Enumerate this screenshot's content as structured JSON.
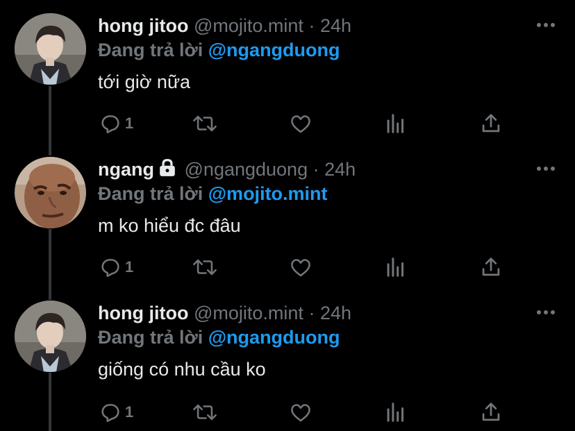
{
  "colors": {
    "background": "#000000",
    "text_primary": "#e7e9ea",
    "text_secondary": "#71767b",
    "mention": "#1d9bf0",
    "thread_line": "#333639"
  },
  "tweets": [
    {
      "display_name": "hong jitoo",
      "handle": "@mojito.mint",
      "separator": "·",
      "time": "24h",
      "locked": false,
      "replying_label": "Đang trả lời",
      "replying_to": "@ngangduong",
      "text": "tới giờ nữa",
      "reply_count": "1",
      "avatar_icon": "profile-photo"
    },
    {
      "display_name": "ngang",
      "handle": "@ngangduong",
      "separator": "·",
      "time": "24h",
      "locked": true,
      "replying_label": "Đang trả lời",
      "replying_to": "@mojito.mint",
      "text": "m ko hiểu đc đâu",
      "reply_count": "1",
      "avatar_icon": "profile-photo"
    },
    {
      "display_name": "hong jitoo",
      "handle": "@mojito.mint",
      "separator": "·",
      "time": "24h",
      "locked": false,
      "replying_label": "Đang trả lời",
      "replying_to": "@ngangduong",
      "text": "giống có nhu cầu ko",
      "reply_count": "1",
      "avatar_icon": "profile-photo"
    }
  ],
  "action_icons": [
    "reply-icon",
    "retweet-icon",
    "like-icon",
    "views-icon",
    "share-icon"
  ]
}
